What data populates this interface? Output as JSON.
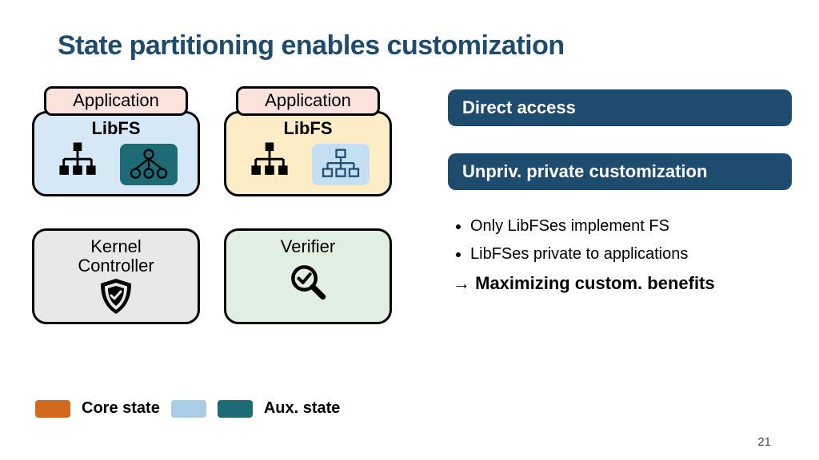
{
  "title": "State partitioning enables customization",
  "stacks": {
    "app_label": "Application",
    "libfs_label": "LibFS"
  },
  "kernel": {
    "label": "Kernel\nController"
  },
  "verifier": {
    "label": "Verifier"
  },
  "legend": {
    "core": "Core state",
    "aux": "Aux. state"
  },
  "right": {
    "banner1": "Direct access",
    "banner2": "Unpriv. private customization",
    "bullet1": "Only LibFSes implement FS",
    "bullet2": "LibFSes private to applications",
    "conclude_arrow": "→",
    "conclude": "Maximizing custom. benefits"
  },
  "page_num": "21"
}
